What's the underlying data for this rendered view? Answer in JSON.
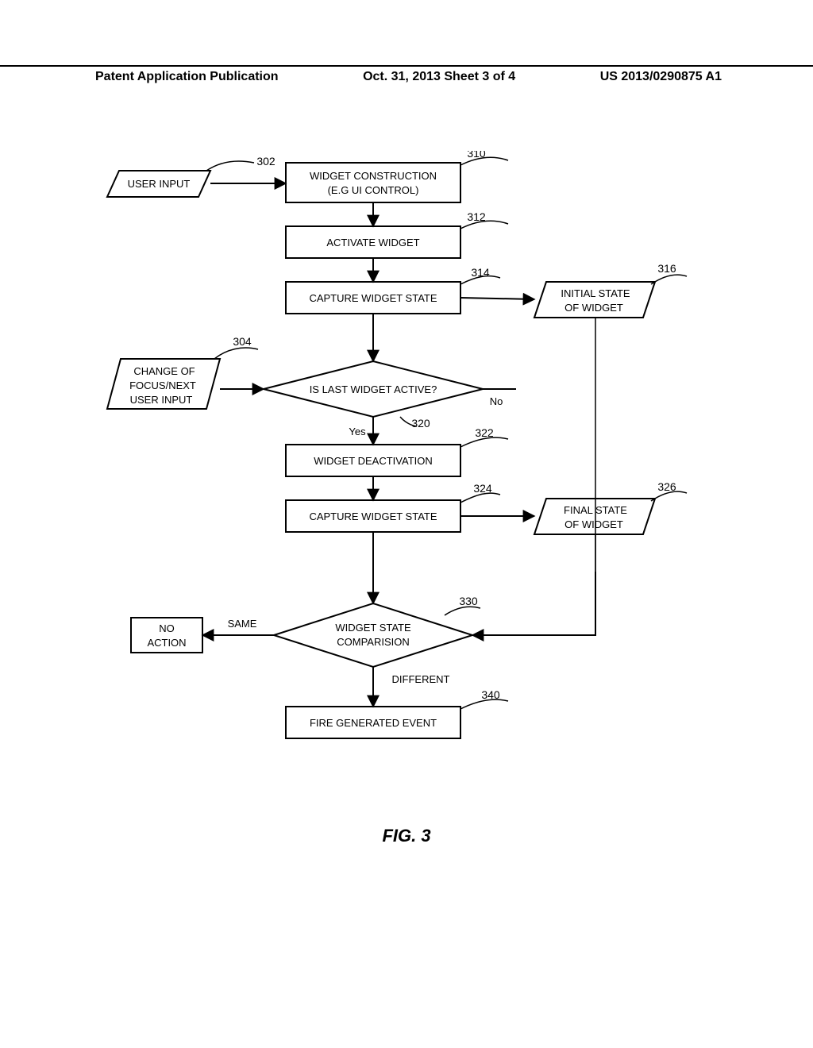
{
  "header": {
    "left": "Patent Application Publication",
    "center": "Oct. 31, 2013  Sheet 3 of 4",
    "right": "US 2013/0290875 A1"
  },
  "nodes": {
    "n302": {
      "text": "USER INPUT",
      "ref": "302"
    },
    "n310": {
      "text1": "WIDGET CONSTRUCTION",
      "text2": "(E.G UI CONTROL)",
      "ref": "310"
    },
    "n312": {
      "text": "ACTIVATE WIDGET",
      "ref": "312"
    },
    "n314": {
      "text": "CAPTURE WIDGET STATE",
      "ref": "314"
    },
    "n316": {
      "text1": "INITIAL STATE",
      "text2": "OF WIDGET",
      "ref": "316"
    },
    "n304": {
      "text1": "CHANGE OF",
      "text2": "FOCUS/NEXT",
      "text3": "USER INPUT",
      "ref": "304"
    },
    "n320": {
      "text": "IS LAST WIDGET ACTIVE?",
      "ref": "320"
    },
    "n322": {
      "text": "WIDGET DEACTIVATION",
      "ref": "322"
    },
    "n324": {
      "text": "CAPTURE WIDGET STATE",
      "ref": "324"
    },
    "n326": {
      "text1": "FINAL STATE",
      "text2": "OF WIDGET",
      "ref": "326"
    },
    "n330": {
      "text1": "WIDGET STATE",
      "text2": "COMPARISION",
      "ref": "330"
    },
    "n332": {
      "text1": "NO",
      "text2": "ACTION"
    },
    "n340": {
      "text": "FIRE GENERATED EVENT",
      "ref": "340"
    }
  },
  "edges": {
    "yes": "Yes",
    "no": "No",
    "same": "SAME",
    "different": "DIFFERENT"
  },
  "caption": "FIG. 3"
}
